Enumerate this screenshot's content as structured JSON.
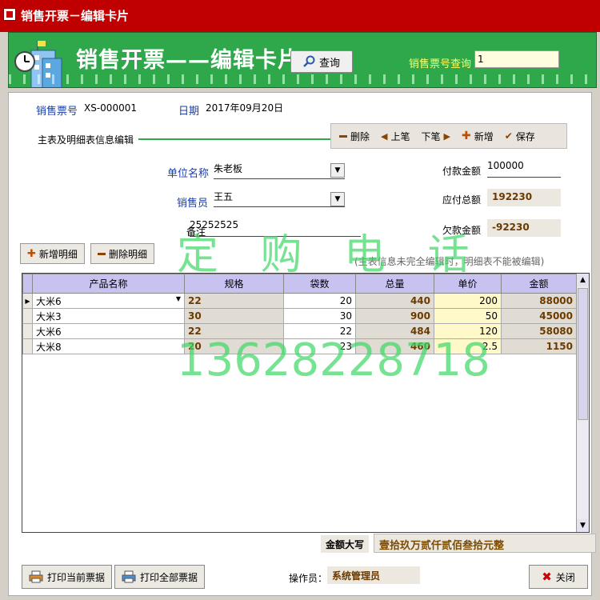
{
  "window": {
    "title": "销售开票－编辑卡片"
  },
  "banner": {
    "title": "销售开票——编辑卡片",
    "search_button": "查询",
    "search_label": "销售票号查询",
    "search_value": "1"
  },
  "header": {
    "invoice_no_label": "销售票号",
    "invoice_no": "XS-000001",
    "date_label": "日期",
    "date": "2017年09月20日",
    "section_label": "主表及明细表信息编辑"
  },
  "toolbar": {
    "delete": "删除",
    "prev": "上笔",
    "next": "下笔",
    "add": "新增",
    "save": "保存"
  },
  "form": {
    "unit_label": "单位名称",
    "unit_value": "朱老板",
    "salesperson_label": "销售员",
    "salesperson_value": "王五",
    "remark_label": "备注",
    "remark_value": "25252525",
    "paid_label": "付款金额",
    "paid_value": "100000",
    "payable_label": "应付总额",
    "payable_value": "192230",
    "owed_label": "欠款金额",
    "owed_value": "-92230"
  },
  "detail_buttons": {
    "add": "新增明细",
    "delete": "删除明细",
    "hint": "(主表信息未完全编辑时，明细表不能被编辑)"
  },
  "table": {
    "columns": [
      "产品名称",
      "规格",
      "袋数",
      "总量",
      "单价",
      "金额"
    ],
    "rows": [
      {
        "name": "大米6",
        "spec": "22",
        "bags": "20",
        "total": "440",
        "price": "200",
        "amount": "88000"
      },
      {
        "name": "大米3",
        "spec": "30",
        "bags": "30",
        "total": "900",
        "price": "50",
        "amount": "45000"
      },
      {
        "name": "大米6",
        "spec": "22",
        "bags": "22",
        "total": "484",
        "price": "120",
        "amount": "58080"
      },
      {
        "name": "大米8",
        "spec": "20",
        "bags": "23",
        "total": "460",
        "price": "2.5",
        "amount": "1150"
      }
    ]
  },
  "watermark": {
    "line1": "定 购 电 话",
    "line2": "13628228718"
  },
  "footer": {
    "capital_label": "金额大写",
    "capital_value": "壹拾玖万贰仟贰佰叁拾元整",
    "print_current": "打印当前票据",
    "print_all": "打印全部票据",
    "operator_label": "操作员：",
    "operator_value": "系统管理员",
    "close": "关闭"
  },
  "colors": {
    "titlebar": "#c00000",
    "banner": "#2ea84a",
    "header_row": "#c7c2f0",
    "price_cell": "#fff8c8"
  }
}
